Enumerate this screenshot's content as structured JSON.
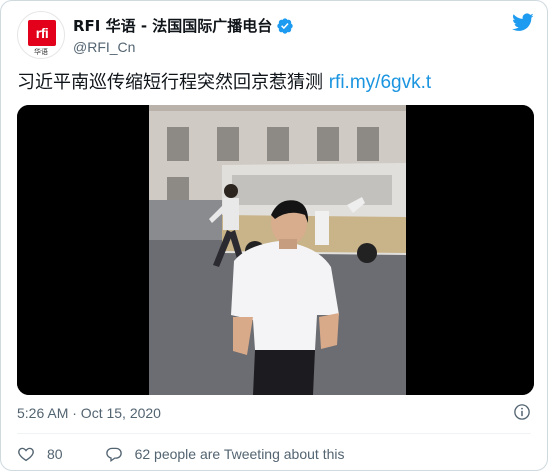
{
  "tweet": {
    "author": {
      "display_name": "RFI 华语 - 法国国际广播电台",
      "handle": "@RFI_Cn",
      "avatar_logo_text": "rfi",
      "avatar_logo_subtext": "华语",
      "verified": true
    },
    "text": "习近平南巡传缩短行程突然回京惹猜测 ",
    "link": "rfi.my/6gvk.t",
    "timestamp": "5:26 AM · Oct 15, 2020",
    "like_count": "80",
    "reply_cta": "62 people are Tweeting about this"
  },
  "icons": {
    "verified": "verified-badge-icon",
    "twitter": "twitter-bird-icon",
    "info": "info-icon",
    "like": "heart-icon",
    "reply": "comment-icon"
  },
  "colors": {
    "link": "#1b95e0",
    "verified": "#1d9bf0",
    "twitter_brand": "#1d9bf0",
    "rfi_red": "#e2001a",
    "secondary_text": "#536471"
  }
}
